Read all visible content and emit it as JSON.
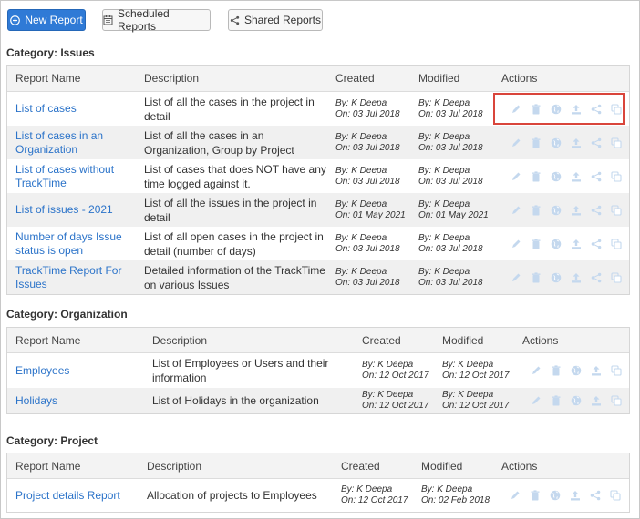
{
  "toolbar": {
    "new_report": "New Report",
    "scheduled_reports": "Scheduled Reports",
    "shared_reports": "Shared Reports"
  },
  "colors": {
    "primary": "#2f7ad6",
    "link": "#2b73c9",
    "action_icon": "#c4d8ee",
    "highlight": "#d9453b"
  },
  "headers": {
    "report_name": "Report Name",
    "description": "Description",
    "created": "Created",
    "modified": "Modified",
    "actions": "Actions"
  },
  "categories": [
    {
      "title": "Category: Issues",
      "rows": [
        {
          "name": [
            "List of cases"
          ],
          "desc": [
            "List of all the cases in the project in",
            "detail"
          ],
          "created_by": "By: K Deepa",
          "created_on": "On: 03 Jul 2018",
          "modified_by": "By: K Deepa",
          "modified_on": "On: 03 Jul 2018"
        },
        {
          "name": [
            "List of cases in an",
            "Organization"
          ],
          "desc": [
            "List of all the cases in an",
            "Organization, Group by Project"
          ],
          "created_by": "By: K Deepa",
          "created_on": "On: 03 Jul 2018",
          "modified_by": "By: K Deepa",
          "modified_on": "On: 03 Jul 2018"
        },
        {
          "name": [
            "List of cases without",
            "TrackTime"
          ],
          "desc": [
            "List of cases that does NOT have any",
            "time logged against it."
          ],
          "created_by": "By: K Deepa",
          "created_on": "On: 03 Jul 2018",
          "modified_by": "By: K Deepa",
          "modified_on": "On: 03 Jul 2018"
        },
        {
          "name": [
            "List of issues - 2021"
          ],
          "desc": [
            "List of all the issues in the project in",
            "detail"
          ],
          "created_by": "By: K Deepa",
          "created_on": "On: 01 May 2021",
          "modified_by": "By: K Deepa",
          "modified_on": "On: 01 May 2021"
        },
        {
          "name": [
            "Number of days Issue",
            "status is open"
          ],
          "desc": [
            "List of all open cases in the project in",
            "detail (number of days)"
          ],
          "created_by": "By: K Deepa",
          "created_on": "On: 03 Jul 2018",
          "modified_by": "By: K Deepa",
          "modified_on": "On: 03 Jul 2018"
        },
        {
          "name": [
            "TrackTime Report For",
            "Issues"
          ],
          "desc": [
            "Detailed information of the TrackTime",
            "on various Issues"
          ],
          "created_by": "By: K Deepa",
          "created_on": "On: 03 Jul 2018",
          "modified_by": "By: K Deepa",
          "modified_on": "On: 03 Jul 2018"
        }
      ]
    },
    {
      "title": "Category: Organization",
      "rows": [
        {
          "name": [
            "Employees"
          ],
          "desc": [
            "List of Employees or Users and their",
            "information"
          ],
          "created_by": "By: K Deepa",
          "created_on": "On: 12 Oct 2017",
          "modified_by": "By: K Deepa",
          "modified_on": "On: 12 Oct 2017"
        },
        {
          "name": [
            "Holidays"
          ],
          "desc": [
            "List of Holidays in the organization"
          ],
          "created_by": "By: K Deepa",
          "created_on": "On: 12 Oct 2017",
          "modified_by": "By: K Deepa",
          "modified_on": "On: 12 Oct 2017"
        }
      ]
    },
    {
      "title": "Category: Project",
      "rows": [
        {
          "name": [
            "Project details Report"
          ],
          "desc": [
            "Allocation of projects to Employees"
          ],
          "created_by": "By: K Deepa",
          "created_on": "On: 12 Oct 2017",
          "modified_by": "By: K Deepa",
          "modified_on": "On: 02 Feb 2018"
        }
      ]
    }
  ]
}
